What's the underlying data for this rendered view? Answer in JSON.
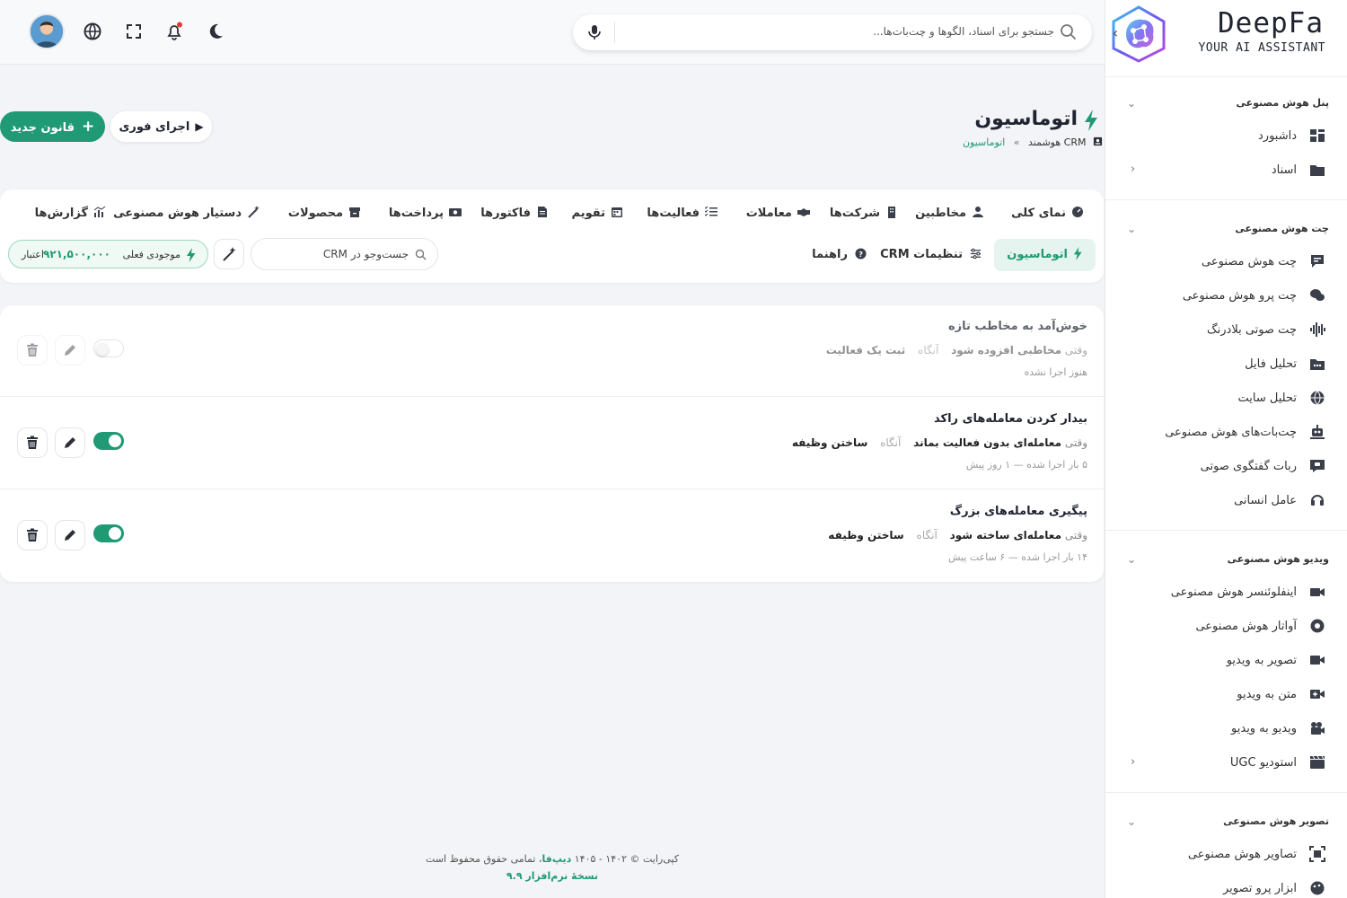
{
  "brand": {
    "name": "DeepFa",
    "tagline": "YOUR AI ASSISTANT"
  },
  "topbar": {
    "search_placeholder": "جستجو برای اسناد، الگوها و چت‌بات‌ها..."
  },
  "sidebar": {
    "sections": [
      {
        "title": "پنل هوش مصنوعی",
        "items": [
          {
            "label": "داشبورد",
            "icon": "dashboard-icon"
          },
          {
            "label": "اسناد",
            "icon": "folder-icon",
            "has_arrow": true
          }
        ]
      },
      {
        "title": "چت هوش مصنوعی",
        "items": [
          {
            "label": "چت هوش مصنوعی",
            "icon": "chat-icon"
          },
          {
            "label": "چت پرو هوش مصنوعی",
            "icon": "chat-pro-icon"
          },
          {
            "label": "چت صوتی بلادرنگ",
            "icon": "waveform-icon"
          },
          {
            "label": "تحلیل فایل",
            "icon": "file-analysis-icon"
          },
          {
            "label": "تحلیل سایت",
            "icon": "globe-icon"
          },
          {
            "label": "چت‌بات‌های هوش مصنوعی",
            "icon": "robot-icon"
          },
          {
            "label": "ربات گفتگوی صوتی",
            "icon": "voice-bot-icon"
          },
          {
            "label": "عامل انسانی",
            "icon": "headset-icon"
          }
        ]
      },
      {
        "title": "ویدیو هوش مصنوعی",
        "items": [
          {
            "label": "اینفلوئنسر هوش مصنوعی",
            "icon": "influencer-icon"
          },
          {
            "label": "آواتار هوش مصنوعی",
            "icon": "avatar-icon"
          },
          {
            "label": "تصویر به ویدیو",
            "icon": "video-icon"
          },
          {
            "label": "متن به ویدیو",
            "icon": "video-plus-icon"
          },
          {
            "label": "ویدیو به ویدیو",
            "icon": "camera-icon"
          },
          {
            "label": "استودیو UGC",
            "icon": "clapper-icon",
            "has_arrow": true
          }
        ]
      },
      {
        "title": "تصویر هوش مصنوعی",
        "items": [
          {
            "label": "تصاویر هوش مصنوعی",
            "icon": "image-scan-icon"
          },
          {
            "label": "ابزار پرو تصویر",
            "icon": "palette-icon"
          }
        ]
      }
    ]
  },
  "page": {
    "title": "اتوماسیون",
    "breadcrumb": {
      "parent": "CRM هوشمند",
      "separator": "»",
      "current": "اتوماسیون"
    },
    "run_now_label": "اجرای فوری",
    "new_rule_label": "قانون جدید"
  },
  "tabs": [
    {
      "label": "نمای کلی",
      "icon": "gauge-icon"
    },
    {
      "label": "مخاطبین",
      "icon": "user-icon"
    },
    {
      "label": "شرکت‌ها",
      "icon": "building-icon"
    },
    {
      "label": "معاملات",
      "icon": "handshake-icon"
    },
    {
      "label": "فعالیت‌ها",
      "icon": "list-check-icon"
    },
    {
      "label": "تقویم",
      "icon": "calendar-icon"
    },
    {
      "label": "فاکتورها",
      "icon": "invoice-icon"
    },
    {
      "label": "پرداخت‌ها",
      "icon": "money-icon"
    },
    {
      "label": "محصولات",
      "icon": "box-icon"
    },
    {
      "label": "دستیار هوش مصنوعی",
      "icon": "magic-wand-icon"
    },
    {
      "label": "گزارش‌ها",
      "icon": "chart-icon"
    }
  ],
  "subtabs": [
    {
      "label": "اتوماسیون",
      "icon": "bolt-icon",
      "active": true
    },
    {
      "label": "تنظیمات CRM",
      "icon": "sliders-icon"
    },
    {
      "label": "راهنما",
      "icon": "help-icon"
    }
  ],
  "crm_search": {
    "placeholder": "جست‌وجو در CRM"
  },
  "balance": {
    "label": "موجودی فعلی",
    "value": "۹۲۱,۵۰۰,۰۰۰",
    "unit": "اعتبار"
  },
  "rules": [
    {
      "title": "خوش‌آمد به مخاطب تازه",
      "when": "وقتی",
      "trigger": "مخاطبی افزوده شود",
      "then": "آنگاه",
      "action": "ثبت یک فعالیت",
      "status": "هنوز اجرا نشده",
      "enabled": false
    },
    {
      "title": "بیدار کردن معامله‌های راکد",
      "when": "وقتی",
      "trigger": "معامله‌ای بدون فعالیت بماند",
      "then": "آنگاه",
      "action": "ساختن وظیفه",
      "status": "۵ بار اجرا شده — ۱ روز پیش",
      "enabled": true
    },
    {
      "title": "پیگیری معامله‌های بزرگ",
      "when": "وقتی",
      "trigger": "معامله‌ای ساخته شود",
      "then": "آنگاه",
      "action": "ساختن وظیفه",
      "status": "۱۴ بار اجرا شده — ۶ ساعت پیش",
      "enabled": true
    }
  ],
  "footer": {
    "copyright_prefix": "کپی‌رایت © ۱۴۰۲ - ۱۴۰۵",
    "brand": "دیپ‌فا",
    "copyright_suffix": "، تمامی حقوق محفوظ است",
    "version": "نسخهٔ نرم‌افزار ۹.۹"
  },
  "colors": {
    "accent": "#1f9a74",
    "notification_dot": "#e53935"
  }
}
